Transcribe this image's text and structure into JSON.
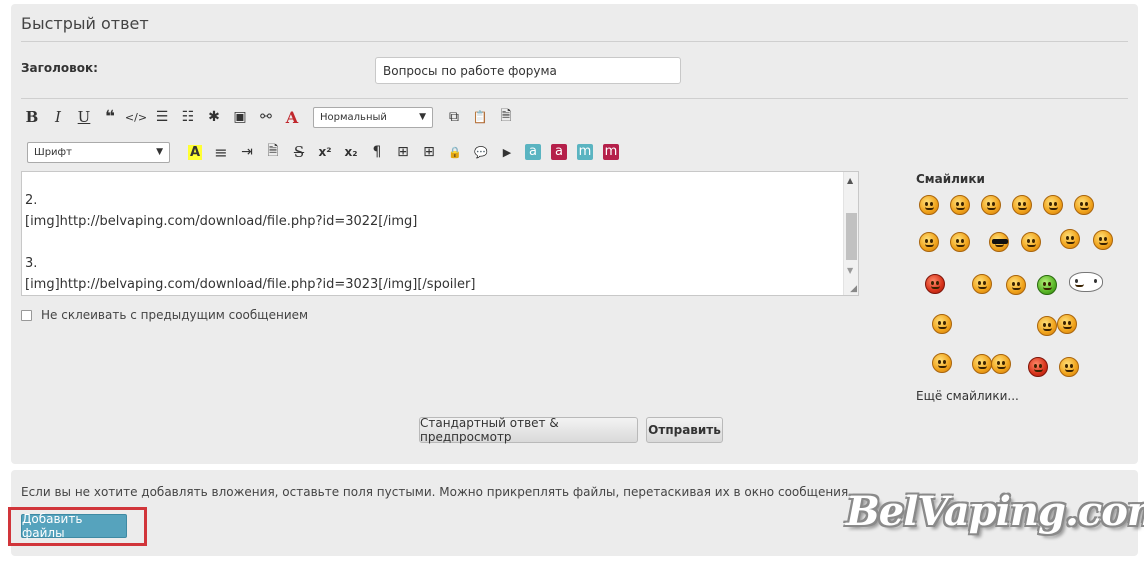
{
  "title": "Быстрый ответ",
  "subject": {
    "label": "Заголовок:",
    "value": "Вопросы по работе форума"
  },
  "toolbar": {
    "row1": {
      "bold": "B",
      "italic": "I",
      "underline": "U",
      "quote": "❝",
      "code": "</>",
      "bullets": "☰",
      "numbers": "☷",
      "star": "✱",
      "image": "▣",
      "link": "⚯",
      "color": "A",
      "size_select": "Нормальный",
      "copy": "⧉",
      "paste": "📋",
      "page": "🗎"
    },
    "row2": {
      "font_select": "Шрифт",
      "highlight": "A",
      "align_center": "≡",
      "indent": "⇥",
      "doc": "🗎",
      "strike": "S",
      "sup": "x²",
      "sub": "x₂",
      "para": "¶",
      "table1": "⊞",
      "table2": "⊞",
      "lock": "🔒",
      "speech": "💬",
      "video": "▶",
      "a_teal": "a",
      "a_red": "a",
      "m_teal": "m",
      "m_red": "m"
    }
  },
  "editor": {
    "text": "2.\n[img]http://belvaping.com/download/file.php?id=3022[/img]\n\n3.\n[img]http://belvaping.com/download/file.php?id=3023[/img][/spoiler]"
  },
  "no_merge_label": "Не склеивать с предыдущим сообщением",
  "smilies": {
    "title": "Смайлики",
    "more": "Ещё смайлики..."
  },
  "buttons": {
    "preview": "Стандартный ответ & предпросмотр",
    "send": "Отправить"
  },
  "attachments": {
    "note": "Если вы не хотите добавлять вложения, оставьте поля пустыми. Можно прикреплять файлы, перетаскивая их в окно сообщения.",
    "add_files": "Добавить файлы"
  },
  "watermark": "BelVaping.com",
  "colors": {
    "panel": "#ececec",
    "add_button": "#56a3bd",
    "highlight_border": "#d1353a",
    "color_a": "#c0272d",
    "teal": "#5ab4c1",
    "crimson": "#b5204a"
  }
}
